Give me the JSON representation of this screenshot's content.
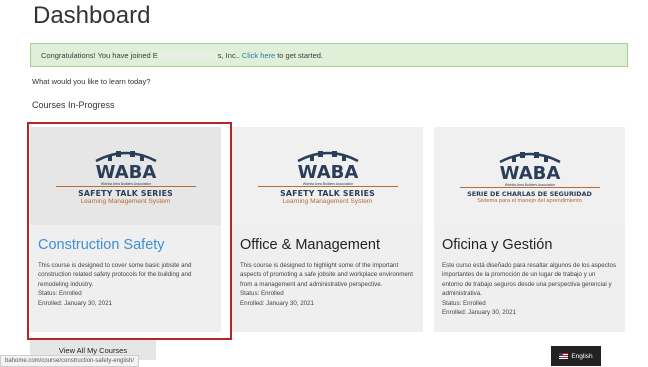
{
  "page": {
    "title": "Dashboard",
    "prompt": "What would you like to learn today?",
    "section_title": "Courses In-Progress"
  },
  "alert": {
    "prefix": "Congratulations! You have joined E",
    "suffix": "s, Inc..",
    "link": "Click here",
    "tail": "to get started."
  },
  "logo": {
    "brand": "WABA",
    "brand_sub": "Wichita Area Builders Association"
  },
  "courses": [
    {
      "tagline": "SAFETY TALK SERIES",
      "subline": "Learning Management System",
      "title": "Construction Safety",
      "description": "This course is designed to cover some basic jobsite and construction related safety protocols for the building and remodeling industry.",
      "status": "Status: Enrolled",
      "enrolled": "Enrolled: January 30, 2021"
    },
    {
      "tagline": "SAFETY TALK SERIES",
      "subline": "Learning Management System",
      "title": "Office & Management",
      "description": "This course is designed to highlight some of the important aspects of promoting a safe jobsite and workplace environment from a management and administrative perspective.",
      "status": "Status: Enrolled",
      "enrolled": "Enrolled: January 30, 2021"
    },
    {
      "tagline": "SERIE DE CHARLAS DE SEGURIDAD",
      "subline": "Sistema para el manejo del aprendimiento",
      "title": "Oficina y Gestión",
      "description": "Este curso está diseñado para resaltar algunos de los aspectos importantes de la promoción de un lugar de trabajo y un entorno de trabajo seguros desde una perspectiva gerencial y administrativa.",
      "status": "Status: Enrolled",
      "enrolled": "Enrolled: January 30, 2021"
    }
  ],
  "buttons": {
    "view_all": "View All My Courses",
    "language": "English"
  },
  "status_bar": {
    "url": "bahome.com/course/construction-safety-english/"
  },
  "colors": {
    "alert_bg": "#dff0d8",
    "link": "#2a7ab8",
    "active_title": "#3f8fd6",
    "highlight": "#b3262a",
    "logo_navy": "#2b3e57",
    "logo_orange": "#b76b35"
  }
}
